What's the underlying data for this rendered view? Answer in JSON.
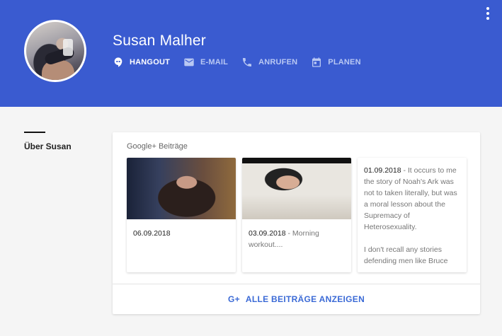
{
  "profile": {
    "name": "Susan Malher"
  },
  "actions": [
    {
      "label": "HANGOUT",
      "icon": "hangout-icon",
      "active": true
    },
    {
      "label": "E-MAIL",
      "icon": "mail-icon",
      "active": false
    },
    {
      "label": "ANRUFEN",
      "icon": "phone-icon",
      "active": false
    },
    {
      "label": "PLANEN",
      "icon": "calendar-icon",
      "active": false
    }
  ],
  "section": {
    "label": "Über Susan"
  },
  "posts_card": {
    "title": "Google+ Beiträge",
    "posts": [
      {
        "date": "06.09.2018",
        "text": ""
      },
      {
        "date": "03.09.2018",
        "text": " - Morning workout...."
      },
      {
        "date": "01.09.2018",
        "text": " - It occurs to me the story of Noah's Ark was not to taken literally, but was a moral lesson about the Supremacy of Heterosexuality.",
        "text2": "I don't recall any stories defending men like Bruce"
      }
    ],
    "show_all": {
      "prefix": "G+",
      "label": "ALLE BEITRÄGE ANZEIGEN"
    }
  },
  "colors": {
    "header": "#3a5bd0",
    "accent": "#3b6ad6"
  }
}
